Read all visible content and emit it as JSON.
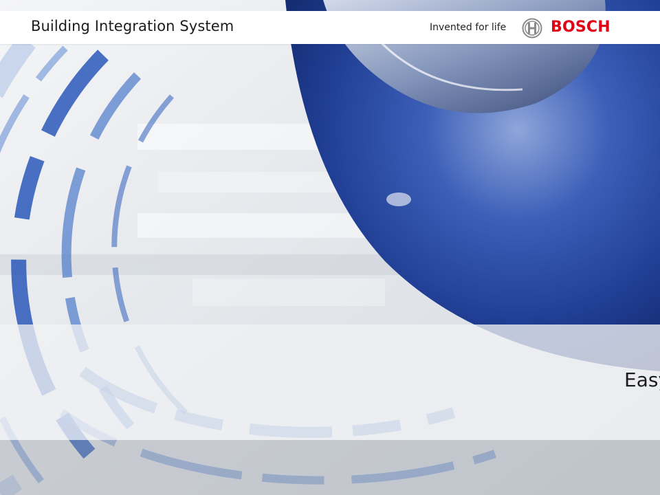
{
  "header": {
    "app_title": "Building Integration System",
    "slogan": "Invented for life",
    "brand_icon": "bosch-armature-icon",
    "brand_name": "BOSCH",
    "brand_color": "#e20015"
  },
  "band": {
    "text": "Easy"
  },
  "colors": {
    "accent_blue": "#2a4fa8",
    "background": "#e9ecef"
  }
}
